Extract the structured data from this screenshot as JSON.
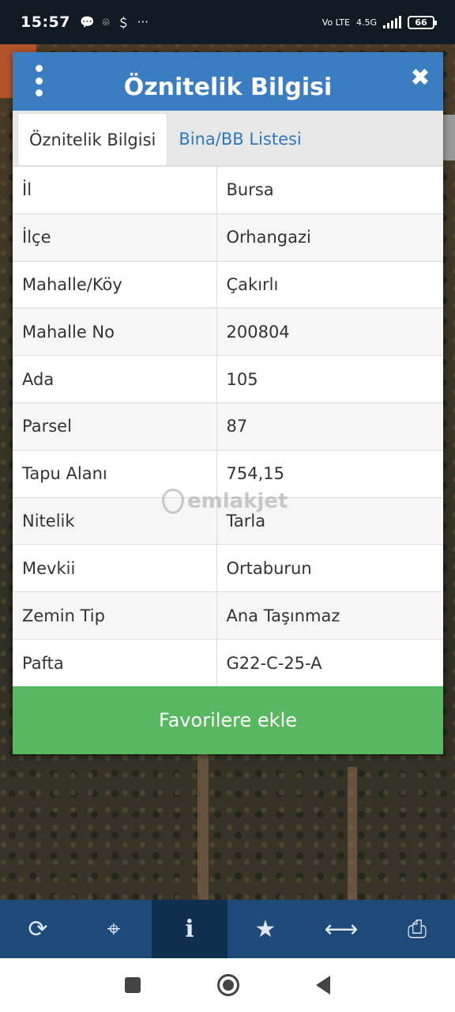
{
  "status_bar": {
    "time": "15:57",
    "left_icons": [
      "chat-bubble-icon",
      "location-alert-icon",
      "dollar-app-icon",
      "more-dots-icon"
    ],
    "network": "4.5G",
    "volte": "Vo LTE",
    "battery": "66"
  },
  "dialog": {
    "title": "Öznitelik Bilgisi",
    "tabs": [
      {
        "label": "Öznitelik Bilgisi",
        "active": true
      },
      {
        "label": "Bina/BB Listesi",
        "active": false
      }
    ],
    "rows": [
      {
        "key": "İl",
        "value": "Bursa"
      },
      {
        "key": "İlçe",
        "value": "Orhangazi"
      },
      {
        "key": "Mahalle/Köy",
        "value": "Çakırlı"
      },
      {
        "key": "Mahalle No",
        "value": "200804"
      },
      {
        "key": "Ada",
        "value": "105"
      },
      {
        "key": "Parsel",
        "value": "87"
      },
      {
        "key": "Tapu Alanı",
        "value": "754,15"
      },
      {
        "key": "Nitelik",
        "value": "Tarla"
      },
      {
        "key": "Mevkii",
        "value": "Ortaburun"
      },
      {
        "key": "Zemin Tip",
        "value": "Ana Taşınmaz"
      },
      {
        "key": "Pafta",
        "value": "G22-C-25-A"
      }
    ],
    "favorite_button": "Favorilere ekle"
  },
  "watermark": "emlakjet",
  "toolbar": {
    "items": [
      "refresh-icon",
      "locate-icon",
      "info-icon",
      "star-icon",
      "measure-icon",
      "print-icon"
    ],
    "active": "info-icon"
  },
  "colors": {
    "header": "#3a7dc0",
    "favorite_button": "#57b861",
    "toolbar": "#1d4a78",
    "tab_link": "#2e78b8"
  }
}
